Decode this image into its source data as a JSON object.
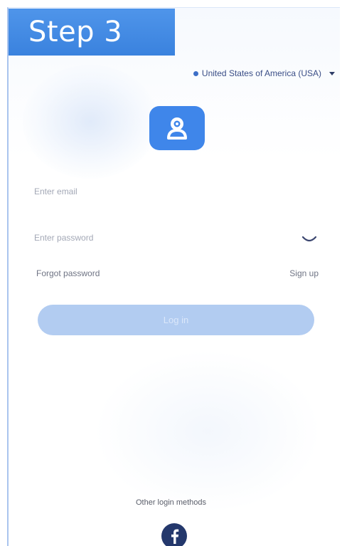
{
  "banner": {
    "step_label": "Step 3"
  },
  "region": {
    "selected": "United States of America (USA)"
  },
  "login": {
    "email_placeholder": "Enter email",
    "password_placeholder": "Enter password",
    "forgot_password_label": "Forgot password",
    "signup_label": "Sign up",
    "login_button_label": "Log in",
    "other_login_methods_label": "Other login methods"
  },
  "colors": {
    "accent": "#3f86ea",
    "login_button_disabled": "#b2ccf1",
    "facebook": "#24386c"
  },
  "icons": {
    "app_logo": "camera-user-icon",
    "password_toggle": "eye-closed-icon",
    "region_marker": "location-dot-icon",
    "region_dropdown": "caret-down-icon",
    "social_login": "facebook-icon"
  }
}
